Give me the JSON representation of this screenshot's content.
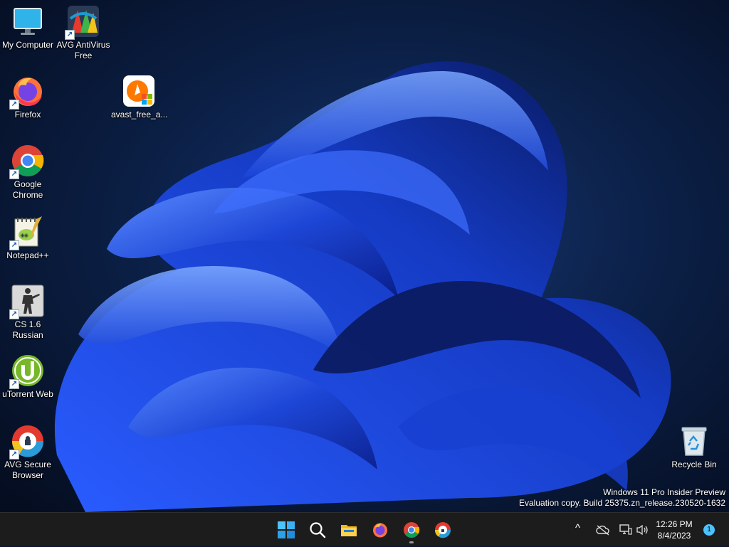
{
  "desktop": {
    "icons": [
      {
        "name": "my-computer",
        "label": "My Computer",
        "shortcut": false
      },
      {
        "name": "avg-antivirus",
        "label": "AVG AntiVirus Free",
        "shortcut": true
      },
      {
        "name": "firefox",
        "label": "Firefox",
        "shortcut": true
      },
      {
        "name": "avast-installer",
        "label": "avast_free_a...",
        "shortcut": false
      },
      {
        "name": "google-chrome",
        "label": "Google Chrome",
        "shortcut": true
      },
      {
        "name": "notepad-plus-plus",
        "label": "Notepad++",
        "shortcut": true
      },
      {
        "name": "cs-16-russian",
        "label": "CS 1.6 Russian",
        "shortcut": true
      },
      {
        "name": "utorrent-web",
        "label": "uTorrent Web",
        "shortcut": true
      },
      {
        "name": "avg-secure-browser",
        "label": "AVG Secure Browser",
        "shortcut": true
      },
      {
        "name": "recycle-bin",
        "label": "Recycle Bin",
        "shortcut": false
      }
    ],
    "shortcut_arrow": "↗"
  },
  "watermark": {
    "line1": "Windows 11 Pro Insider Preview",
    "line2": "Evaluation copy. Build 25375.zn_release.230520-1632"
  },
  "taskbar": {
    "pinned": [
      "start-icon",
      "search-icon",
      "file-explorer-icon",
      "firefox-icon",
      "chrome-icon",
      "avg-secure-browser-icon"
    ],
    "tray": {
      "overflow_chevron": "^",
      "time": "12:26 PM",
      "date": "8/4/2023",
      "notification_count": "1"
    }
  },
  "colors": {
    "taskbar_bg": "#1c1c1c",
    "wallpaper_dark": "#071530",
    "bloom_blue": "#1f4fe0",
    "accent": "#4cc2ff"
  }
}
